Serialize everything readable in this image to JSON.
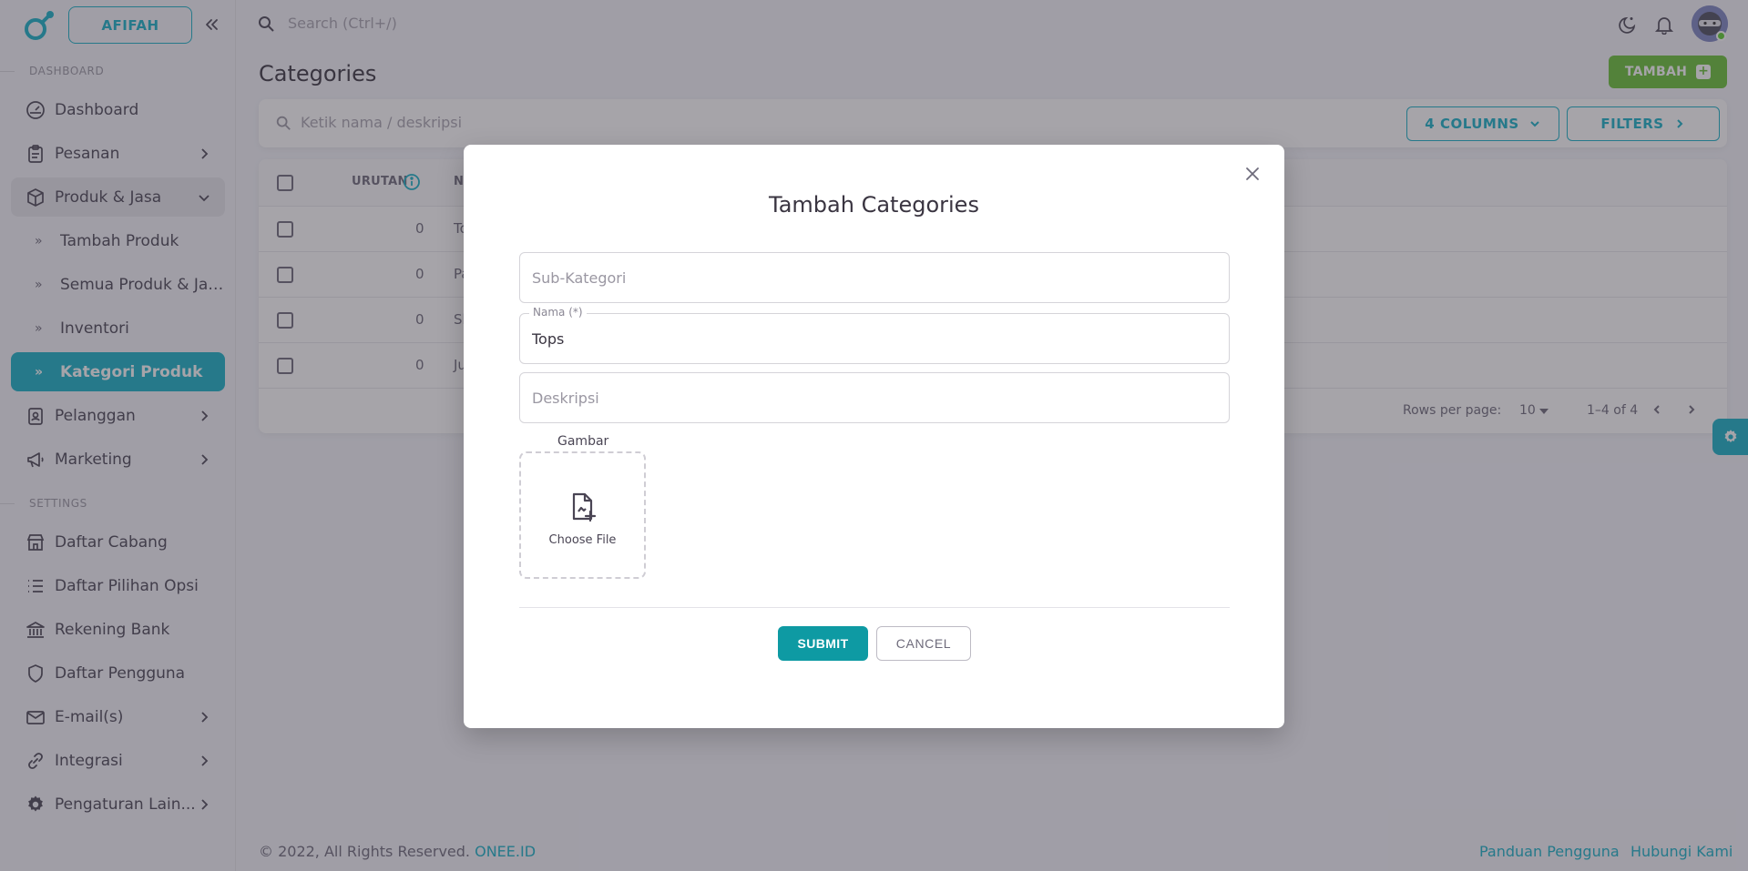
{
  "brand": {
    "name": "AFIFAH"
  },
  "topbar": {
    "search_placeholder": "Search (Ctrl+/)"
  },
  "sidebar": {
    "dashboard_section": "DASHBOARD",
    "settings_section": "SETTINGS",
    "items": [
      {
        "label": "Dashboard",
        "icon": "dashboard-icon"
      },
      {
        "label": "Pesanan",
        "icon": "clipboard-icon"
      },
      {
        "label": "Produk & Jasa",
        "icon": "box-icon"
      },
      {
        "label": "Tambah Produk"
      },
      {
        "label": "Semua Produk & Jasa"
      },
      {
        "label": "Inventori"
      },
      {
        "label": "Kategori Produk"
      },
      {
        "label": "Pelanggan",
        "icon": "contacts-icon"
      },
      {
        "label": "Marketing",
        "icon": "megaphone-icon"
      }
    ],
    "settings_items": [
      {
        "label": "Daftar Cabang",
        "icon": "store-icon"
      },
      {
        "label": "Daftar Pilihan Opsi",
        "icon": "list-icon"
      },
      {
        "label": "Rekening Bank",
        "icon": "bank-icon"
      },
      {
        "label": "Daftar Pengguna",
        "icon": "shield-icon"
      },
      {
        "label": "E-mail(s)",
        "icon": "mail-icon"
      },
      {
        "label": "Integrasi",
        "icon": "link-icon"
      },
      {
        "label": "Pengaturan Lain...",
        "icon": "gear-icon"
      }
    ]
  },
  "page": {
    "title": "Categories",
    "add_button": "TAMBAH",
    "filter_placeholder": "Ketik nama / deskripsi",
    "columns_button": "4 COLUMNS",
    "filters_button": "FILTERS"
  },
  "table": {
    "headers": [
      "URUTAN",
      "NA"
    ],
    "rows": [
      {
        "urutan": "0",
        "name": "To"
      },
      {
        "urutan": "0",
        "name": "Pa"
      },
      {
        "urutan": "0",
        "name": "Sh"
      },
      {
        "urutan": "0",
        "name": "Ju"
      }
    ],
    "rows_per_page_label": "Rows per page:",
    "rows_per_page": "10",
    "range": "1–4 of 4"
  },
  "footer": {
    "copyright": "© 2022, All Rights Reserved.",
    "brand_link": "ONEE.ID",
    "guide_link": "Panduan Pengguna",
    "contact_link": "Hubungi Kami"
  },
  "modal": {
    "title": "Tambah Categories",
    "subcategory_placeholder": "Sub-Kategori",
    "name_label": "Nama (*)",
    "name_value": "Tops",
    "description_placeholder": "Deskripsi",
    "image_label": "Gambar",
    "choose_file": "Choose File",
    "submit": "SUBMIT",
    "cancel": "CANCEL"
  },
  "colors": {
    "accent": "#16b1c7",
    "success": "#68c236",
    "submit": "#0e9aa3"
  }
}
